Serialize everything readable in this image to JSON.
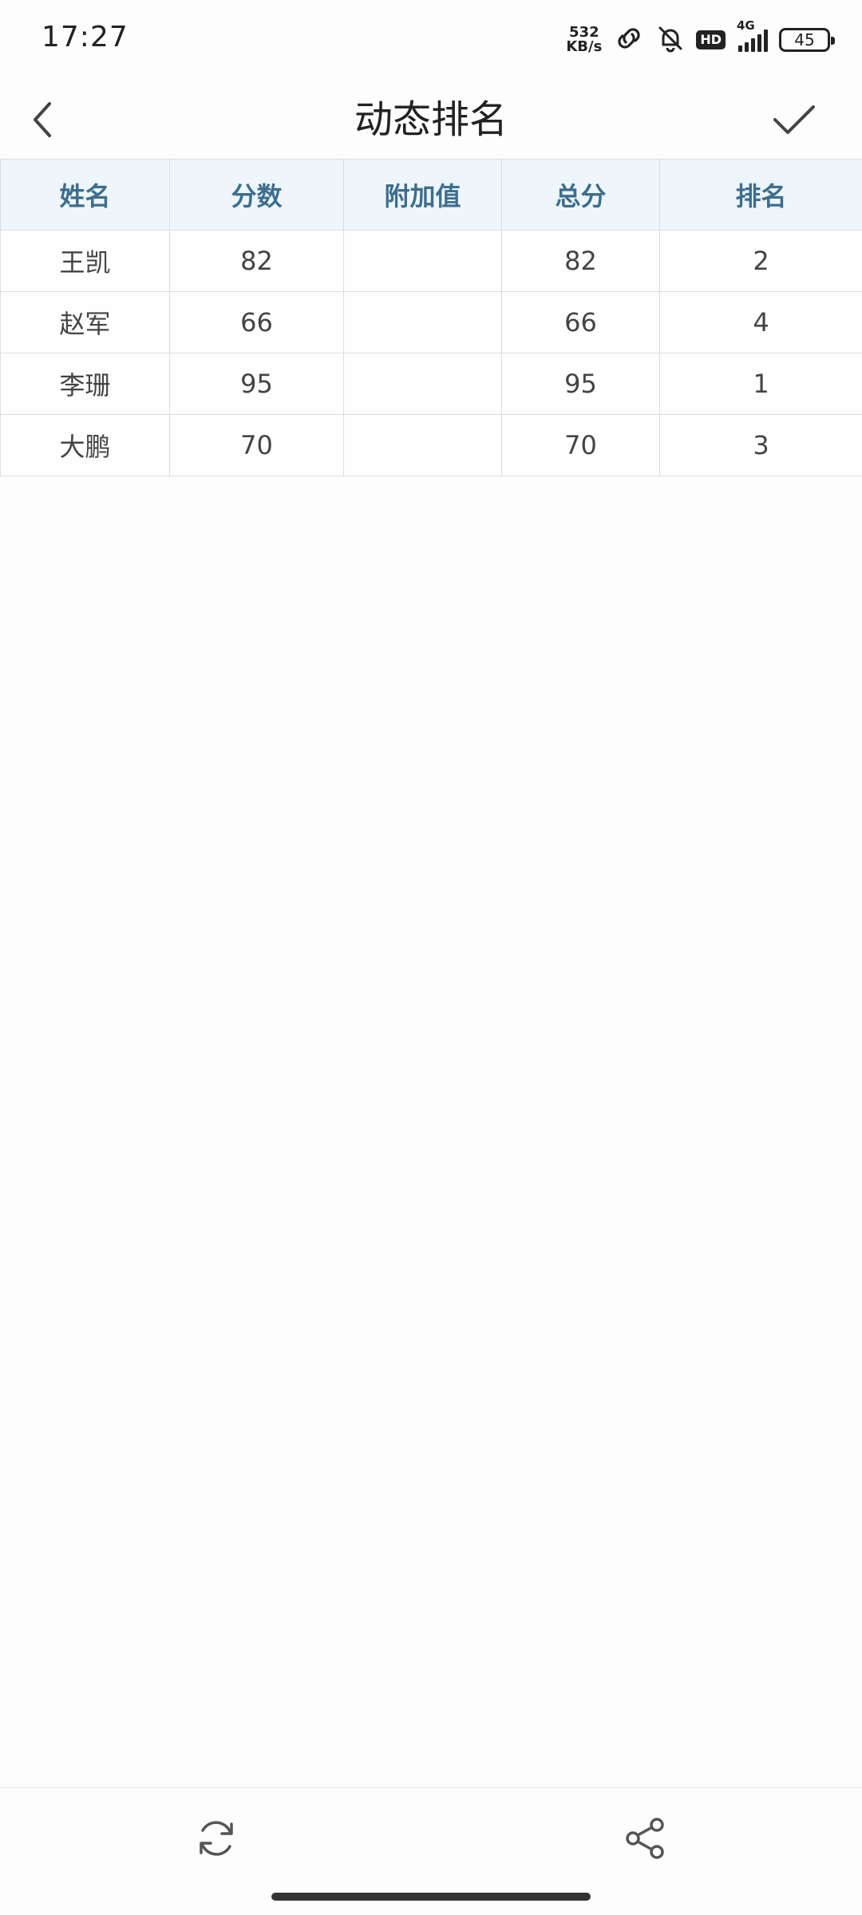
{
  "status_bar": {
    "time": "17:27",
    "net_speed_value": "532",
    "net_speed_unit": "KB/s",
    "hd_label": "HD",
    "network_type": "4G",
    "battery_level": "45",
    "icons": [
      "link-icon",
      "bell-off-icon",
      "hd-icon",
      "signal-icon",
      "battery-icon"
    ]
  },
  "header": {
    "title": "动态排名",
    "back_icon": "chevron-left-icon",
    "confirm_icon": "checkmark-icon"
  },
  "table": {
    "columns": [
      "姓名",
      "分数",
      "附加值",
      "总分",
      "排名"
    ],
    "rows": [
      [
        "王凯",
        "82",
        "",
        "82",
        "2"
      ],
      [
        "赵军",
        "66",
        "",
        "66",
        "4"
      ],
      [
        "李珊",
        "95",
        "",
        "95",
        "1"
      ],
      [
        "大鹏",
        "70",
        "",
        "70",
        "3"
      ]
    ]
  },
  "bottom_bar": {
    "refresh_icon": "refresh-icon",
    "share_icon": "share-icon"
  },
  "colors": {
    "header_row_bg": "#eef6fc",
    "header_text": "#3e6e8c",
    "grid_line": "#d9dde1",
    "page_bg": "#fdfdfd"
  }
}
